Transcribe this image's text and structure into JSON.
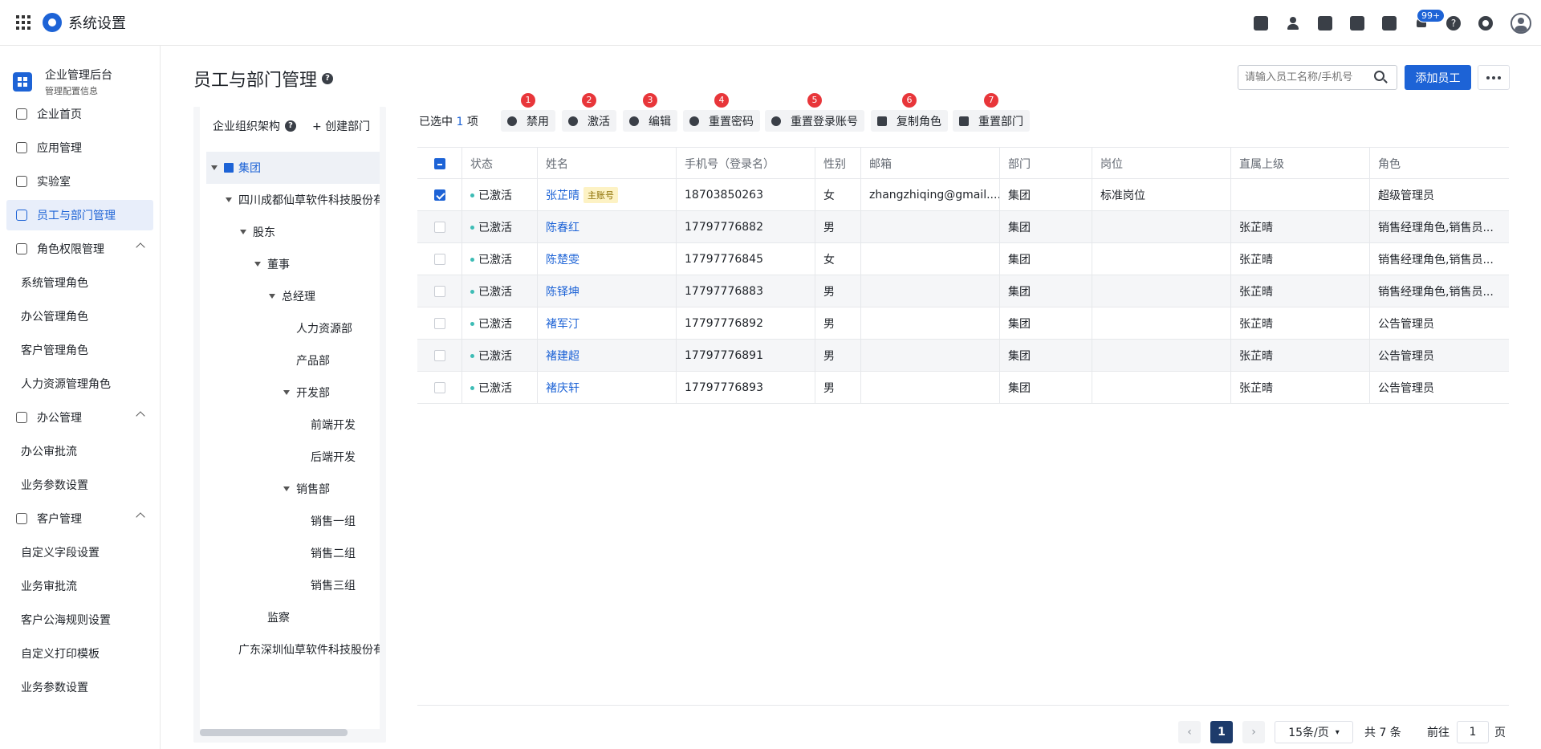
{
  "app": {
    "title": "系统设置"
  },
  "topbar": {
    "notification_badge": "99+"
  },
  "sidebar": {
    "brand_title": "企业管理后台",
    "brand_subtitle": "管理配置信息",
    "items": [
      {
        "label": "企业首页",
        "type": "item"
      },
      {
        "label": "应用管理",
        "type": "item"
      },
      {
        "label": "实验室",
        "type": "item"
      },
      {
        "label": "员工与部门管理",
        "type": "item",
        "active": true
      },
      {
        "label": "角色权限管理",
        "type": "group"
      },
      {
        "label": "系统管理角色",
        "type": "sub"
      },
      {
        "label": "办公管理角色",
        "type": "sub"
      },
      {
        "label": "客户管理角色",
        "type": "sub"
      },
      {
        "label": "人力资源管理角色",
        "type": "sub"
      },
      {
        "label": "办公管理",
        "type": "group"
      },
      {
        "label": "办公审批流",
        "type": "sub"
      },
      {
        "label": "业务参数设置",
        "type": "sub"
      },
      {
        "label": "客户管理",
        "type": "group"
      },
      {
        "label": "自定义字段设置",
        "type": "sub"
      },
      {
        "label": "业务审批流",
        "type": "sub"
      },
      {
        "label": "客户公海规则设置",
        "type": "sub"
      },
      {
        "label": "自定义打印模板",
        "type": "sub"
      },
      {
        "label": "业务参数设置",
        "type": "sub"
      }
    ]
  },
  "page": {
    "title": "员工与部门管理",
    "search_placeholder": "请输入员工名称/手机号",
    "add_button": "添加员工"
  },
  "org_tree": {
    "title": "企业组织架构",
    "create_label": "+ 创建部门",
    "nodes": [
      {
        "label": "集团",
        "level": 0,
        "expanded": true,
        "selected": true
      },
      {
        "label": "四川成都仙草软件科技股份有",
        "level": 1,
        "expanded": true
      },
      {
        "label": "股东",
        "level": 2,
        "expanded": true
      },
      {
        "label": "董事",
        "level": 3,
        "expanded": true
      },
      {
        "label": "总经理",
        "level": 4,
        "expanded": true
      },
      {
        "label": "人力资源部",
        "level": 5
      },
      {
        "label": "产品部",
        "level": 5
      },
      {
        "label": "开发部",
        "level": 5,
        "expanded": true
      },
      {
        "label": "前端开发",
        "level": 6
      },
      {
        "label": "后端开发",
        "level": 6
      },
      {
        "label": "销售部",
        "level": 5,
        "expanded": true
      },
      {
        "label": "销售一组",
        "level": 6
      },
      {
        "label": "销售二组",
        "level": 6
      },
      {
        "label": "销售三组",
        "level": 6
      },
      {
        "label": "监察",
        "level": 3
      },
      {
        "label": "广东深圳仙草软件科技股份有",
        "level": 1
      }
    ]
  },
  "toolbar": {
    "selected_prefix": "已选中",
    "selected_count": "1",
    "selected_suffix": "项",
    "buttons": [
      {
        "label": "禁用",
        "marker": "1"
      },
      {
        "label": "激活",
        "marker": "2"
      },
      {
        "label": "编辑",
        "marker": "3"
      },
      {
        "label": "重置密码",
        "marker": "4"
      },
      {
        "label": "重置登录账号",
        "marker": "5"
      },
      {
        "label": "复制角色",
        "marker": "6"
      },
      {
        "label": "重置部门",
        "marker": "7"
      }
    ]
  },
  "table": {
    "headers": [
      "状态",
      "姓名",
      "手机号（登录名）",
      "性别",
      "邮箱",
      "部门",
      "岗位",
      "直属上级",
      "角色"
    ],
    "main_account_tag": "主账号",
    "rows": [
      {
        "checked": true,
        "status": "已激活",
        "name": "张芷晴",
        "main": true,
        "phone": "18703850263",
        "gender": "女",
        "email": "zhangzhiqing@gmail....",
        "dept": "集团",
        "post": "标准岗位",
        "superior": "",
        "role": "超级管理员"
      },
      {
        "checked": false,
        "status": "已激活",
        "name": "陈春红",
        "phone": "17797776882",
        "gender": "男",
        "email": "",
        "dept": "集团",
        "post": "",
        "superior": "张芷晴",
        "role": "销售经理角色,销售员..."
      },
      {
        "checked": false,
        "status": "已激活",
        "name": "陈楚雯",
        "phone": "17797776845",
        "gender": "女",
        "email": "",
        "dept": "集团",
        "post": "",
        "superior": "张芷晴",
        "role": "销售经理角色,销售员..."
      },
      {
        "checked": false,
        "status": "已激活",
        "name": "陈铎坤",
        "phone": "17797776883",
        "gender": "男",
        "email": "",
        "dept": "集团",
        "post": "",
        "superior": "张芷晴",
        "role": "销售经理角色,销售员..."
      },
      {
        "checked": false,
        "status": "已激活",
        "name": "褚军汀",
        "phone": "17797776892",
        "gender": "男",
        "email": "",
        "dept": "集团",
        "post": "",
        "superior": "张芷晴",
        "role": "公告管理员"
      },
      {
        "checked": false,
        "status": "已激活",
        "name": "褚建超",
        "phone": "17797776891",
        "gender": "男",
        "email": "",
        "dept": "集团",
        "post": "",
        "superior": "张芷晴",
        "role": "公告管理员"
      },
      {
        "checked": false,
        "status": "已激活",
        "name": "褚庆轩",
        "phone": "17797776893",
        "gender": "男",
        "email": "",
        "dept": "集团",
        "post": "",
        "superior": "张芷晴",
        "role": "公告管理员"
      }
    ]
  },
  "pagination": {
    "current": "1",
    "page_size": "15条/页",
    "total": "共 7 条",
    "goto_prefix": "前往",
    "goto_value": "1",
    "goto_suffix": "页"
  }
}
